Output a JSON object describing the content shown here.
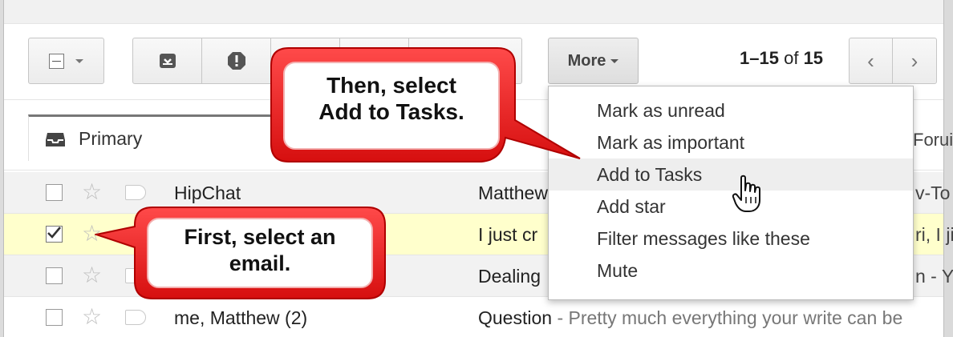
{
  "toolbar": {
    "select_icon": "select-all-checkbox-icon",
    "archive_icon": "archive-icon",
    "spam_icon": "report-spam-icon",
    "more_label": "More",
    "pager": {
      "range": "1–15",
      "of": "of",
      "total": "15"
    },
    "prev_icon": "chevron-left-icon",
    "next_icon": "chevron-right-icon"
  },
  "tabs": {
    "primary_label": "Primary",
    "primary_icon": "inbox-tray-icon",
    "forums_partial": "Forui"
  },
  "menu": {
    "items": [
      "Mark as unread",
      "Mark as important",
      "Add to Tasks",
      "Add star",
      "Filter messages like these",
      "Mute"
    ],
    "hover_index": 2
  },
  "emails": [
    {
      "sender": "HipChat",
      "subject": "Matthew",
      "snippet": "",
      "tail": "v-To",
      "checked": false
    },
    {
      "sender": "",
      "subject": "I just cr",
      "snippet": "",
      "tail": "ri, I ji",
      "checked": true
    },
    {
      "sender": "",
      "subject": "Dealing",
      "snippet": "",
      "tail": "n - Y",
      "checked": false
    },
    {
      "sender": "me, Matthew (2)",
      "subject": "Question",
      "snippet": " - Pretty much everything your write can be",
      "tail": "",
      "checked": false
    }
  ],
  "callouts": {
    "first": {
      "line1": "First, select an",
      "line2": "email."
    },
    "then": {
      "line1": "Then, select",
      "line2": "Add to Tasks."
    }
  },
  "colors": {
    "callout_fill": "#ee1c1c",
    "callout_inner": "#ffffff",
    "selected_row": "#ffffcc",
    "menu_hover": "#eeeeee"
  }
}
